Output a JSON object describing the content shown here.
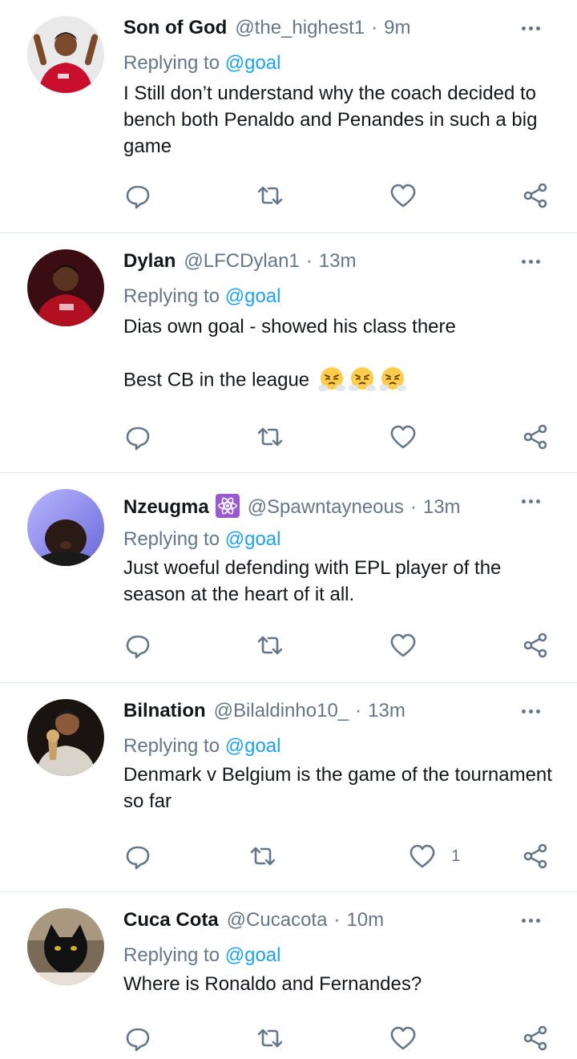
{
  "feed": {
    "tweets": [
      {
        "name": "Son of God",
        "handle": "@the_highest1",
        "dot": "·",
        "time": "9m",
        "replying_prefix": "Replying to ",
        "replying_to": "@goal",
        "text": "I Still don’t understand why the coach decided to bench both Penaldo and Penandes in such a big game",
        "avatar_colors": {
          "bg": "#c8102e",
          "skin": "#7a4a2a"
        }
      },
      {
        "name": "Dylan",
        "handle": "@LFCDylan1",
        "dot": "·",
        "time": "13m",
        "replying_prefix": "Replying to ",
        "replying_to": "@goal",
        "text": "Dias own goal - showed his class there\n\nBest CB in the league",
        "emoji": "face-with-steam-from-nose",
        "emoji_count": 3,
        "avatar_colors": {
          "bg": "#3a0d12",
          "skin": "#5a3420"
        }
      },
      {
        "name": "Nzeugma",
        "handle": "@Spawntayneous",
        "dot": "·",
        "time": "13m",
        "badge_icon": "atom-icon",
        "replying_prefix": "Replying to ",
        "replying_to": "@goal",
        "text": "Just woeful defending with EPL player of the season at the heart of it all.",
        "avatar_colors": {
          "bg": "#8a88ee",
          "skin": "#2a1a14"
        }
      },
      {
        "name": "Bilnation",
        "handle": "@Bilaldinho10_",
        "dot": "·",
        "time": "13m",
        "replying_prefix": "Replying to ",
        "replying_to": "@goal",
        "text": "Denmark v Belgium is the game of the tournament so far",
        "like_count": "1",
        "avatar_colors": {
          "bg": "#1a1410",
          "skin": "#c9a06a"
        }
      },
      {
        "name": "Cuca Cota",
        "handle": "@Cucacota",
        "dot": "·",
        "time": "10m",
        "replying_prefix": "Replying to ",
        "replying_to": "@goal",
        "text": "Where is Ronaldo and Fernandes?",
        "avatar_colors": {
          "bg": "#7a6a58",
          "skin": "#111111"
        }
      }
    ],
    "icons": {
      "reply": "reply-icon",
      "retweet": "retweet-icon",
      "like": "heart-icon",
      "share": "share-icon",
      "more": "more-icon"
    },
    "colors": {
      "text": "#14171a",
      "secondary": "#657786",
      "accent": "#1da1f2",
      "divider": "#e1e8ed"
    }
  }
}
